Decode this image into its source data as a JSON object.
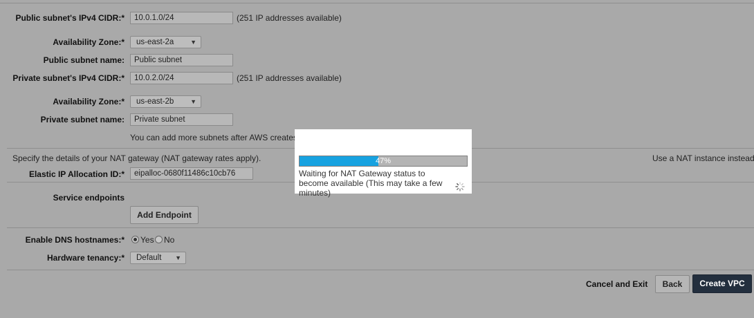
{
  "public_subnet": {
    "cidr_label": "Public subnet's IPv4 CIDR:*",
    "cidr_value": "10.0.1.0/24",
    "cidr_hint": "(251 IP addresses available)",
    "az_label": "Availability Zone:*",
    "az_value": "us-east-2a",
    "name_label": "Public subnet name:",
    "name_value": "Public subnet"
  },
  "private_subnet": {
    "cidr_label": "Private subnet's IPv4 CIDR:*",
    "cidr_value": "10.0.2.0/24",
    "cidr_hint": "(251 IP addresses available)",
    "az_label": "Availability Zone:*",
    "az_value": "us-east-2b",
    "name_label": "Private subnet name:",
    "name_value": "Private subnet"
  },
  "subnet_note": "You can add more subnets after AWS creates th",
  "nat": {
    "description": "Specify the details of your NAT gateway (NAT gateway rates apply).",
    "use_instance_link": "Use a NAT instance instead",
    "eip_label": "Elastic IP Allocation ID:*",
    "eip_value": "eipalloc-0680f11486c10cb76"
  },
  "endpoints": {
    "label": "Service endpoints",
    "add_button": "Add Endpoint"
  },
  "dns": {
    "label": "Enable DNS hostnames:*",
    "yes": "Yes",
    "no": "No",
    "selected": "Yes"
  },
  "tenancy": {
    "label": "Hardware tenancy:*",
    "value": "Default"
  },
  "footer": {
    "cancel": "Cancel and Exit",
    "back": "Back",
    "create": "Create VPC"
  },
  "modal": {
    "progress_percent": 47,
    "progress_text": "47%",
    "message": "Waiting for NAT Gateway status to become available (This may take a few minutes)"
  },
  "colors": {
    "overlay": "#a9a9a9",
    "progress_fill": "#17a2e0",
    "primary_button": "#232f3e"
  }
}
